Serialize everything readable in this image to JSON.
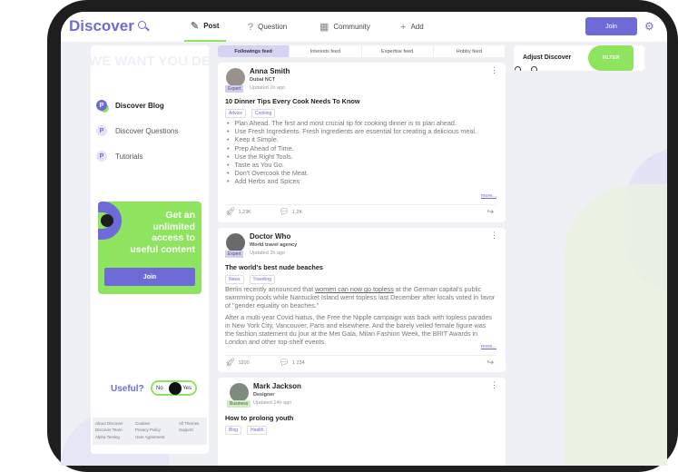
{
  "header": {
    "logo": "Discover",
    "nav": [
      {
        "label": "Post",
        "icon": "edit-icon"
      },
      {
        "label": "Question",
        "icon": "question-icon"
      },
      {
        "label": "Community",
        "icon": "grid-icon"
      },
      {
        "label": "Add",
        "icon": "plus-icon"
      }
    ],
    "join": "Join"
  },
  "sidebar": {
    "banner": "WE WANT YOU DEVELOP",
    "items": [
      {
        "label": "Discover Blog"
      },
      {
        "label": "Discover Questions"
      },
      {
        "label": "Tutorials"
      }
    ],
    "promo": {
      "text": "Get an unlimited access to useful content",
      "button": "Join"
    },
    "useful": {
      "label": "Useful?",
      "no": "No",
      "yes": "Yes"
    },
    "footer": [
      "About Discover",
      "Cookies",
      "All Themes",
      "Discover Team",
      "Privacy Policy",
      "Support",
      "Alpha Testing",
      "User Agreement",
      ""
    ]
  },
  "feed_tabs": [
    "Followings feed",
    "Interests feed",
    "Expertise feed",
    "Hobby feed"
  ],
  "posts": [
    {
      "name": "Anna Smith",
      "badge": "Expert",
      "sub": "Dubai NCT",
      "updated": "Updated 1h ago",
      "title": "10 Dinner Tips Every Cook Needs To Know",
      "tags": [
        "Advice",
        "Cooking"
      ],
      "bullets": [
        "Plan Ahead. The first and most crucial tip for cooking dinner is to plan ahead.",
        "Use Fresh Ingredients. Fresh ingredients are essential for creating a delicious meal.",
        "Keep it Simple.",
        "Prep Ahead of Time.",
        "Use the Right Tools.",
        "Taste as You Go.",
        "Don't Overcook the Meat.",
        "Add Herbs and Spices"
      ],
      "more": "more...",
      "likes": "1,23K",
      "comments": "1,2K"
    },
    {
      "name": "Doctor Who",
      "badge": "Expert",
      "sub": "World travel agency",
      "updated": "Updated 2h ago",
      "title": "The world's best nude beaches",
      "tags": [
        "News",
        "Traveling"
      ],
      "p1a": "Berlin recently announced that ",
      "p1link": "women can now go topless",
      "p1b": " at the German capital's public swimming pools while Nantucket Island went topless last December after locals voted in favor of \"gender equality on beaches.\"",
      "p2": "After a multi-year Covid hiatus, the Free the Nipple campaign was back with topless parades in New York City, Vancouver, Paris and elsewhere. And the barely veiled female figure was the fashion statement du jour at the Met Gala, Milan Fashion Week, the BRIT Awards in London and other top-shelf events.",
      "more": "more...",
      "likes": "1200",
      "comments": "1 234"
    },
    {
      "name": "Mark Jackson",
      "badge": "Business",
      "sub": "Designer",
      "updated": "Updated 14h ago",
      "title": "How to prolong youth",
      "tags": [
        "Blog",
        "Health"
      ]
    }
  ],
  "right": {
    "title": "Adjust Discover",
    "filter": "FILTER"
  }
}
